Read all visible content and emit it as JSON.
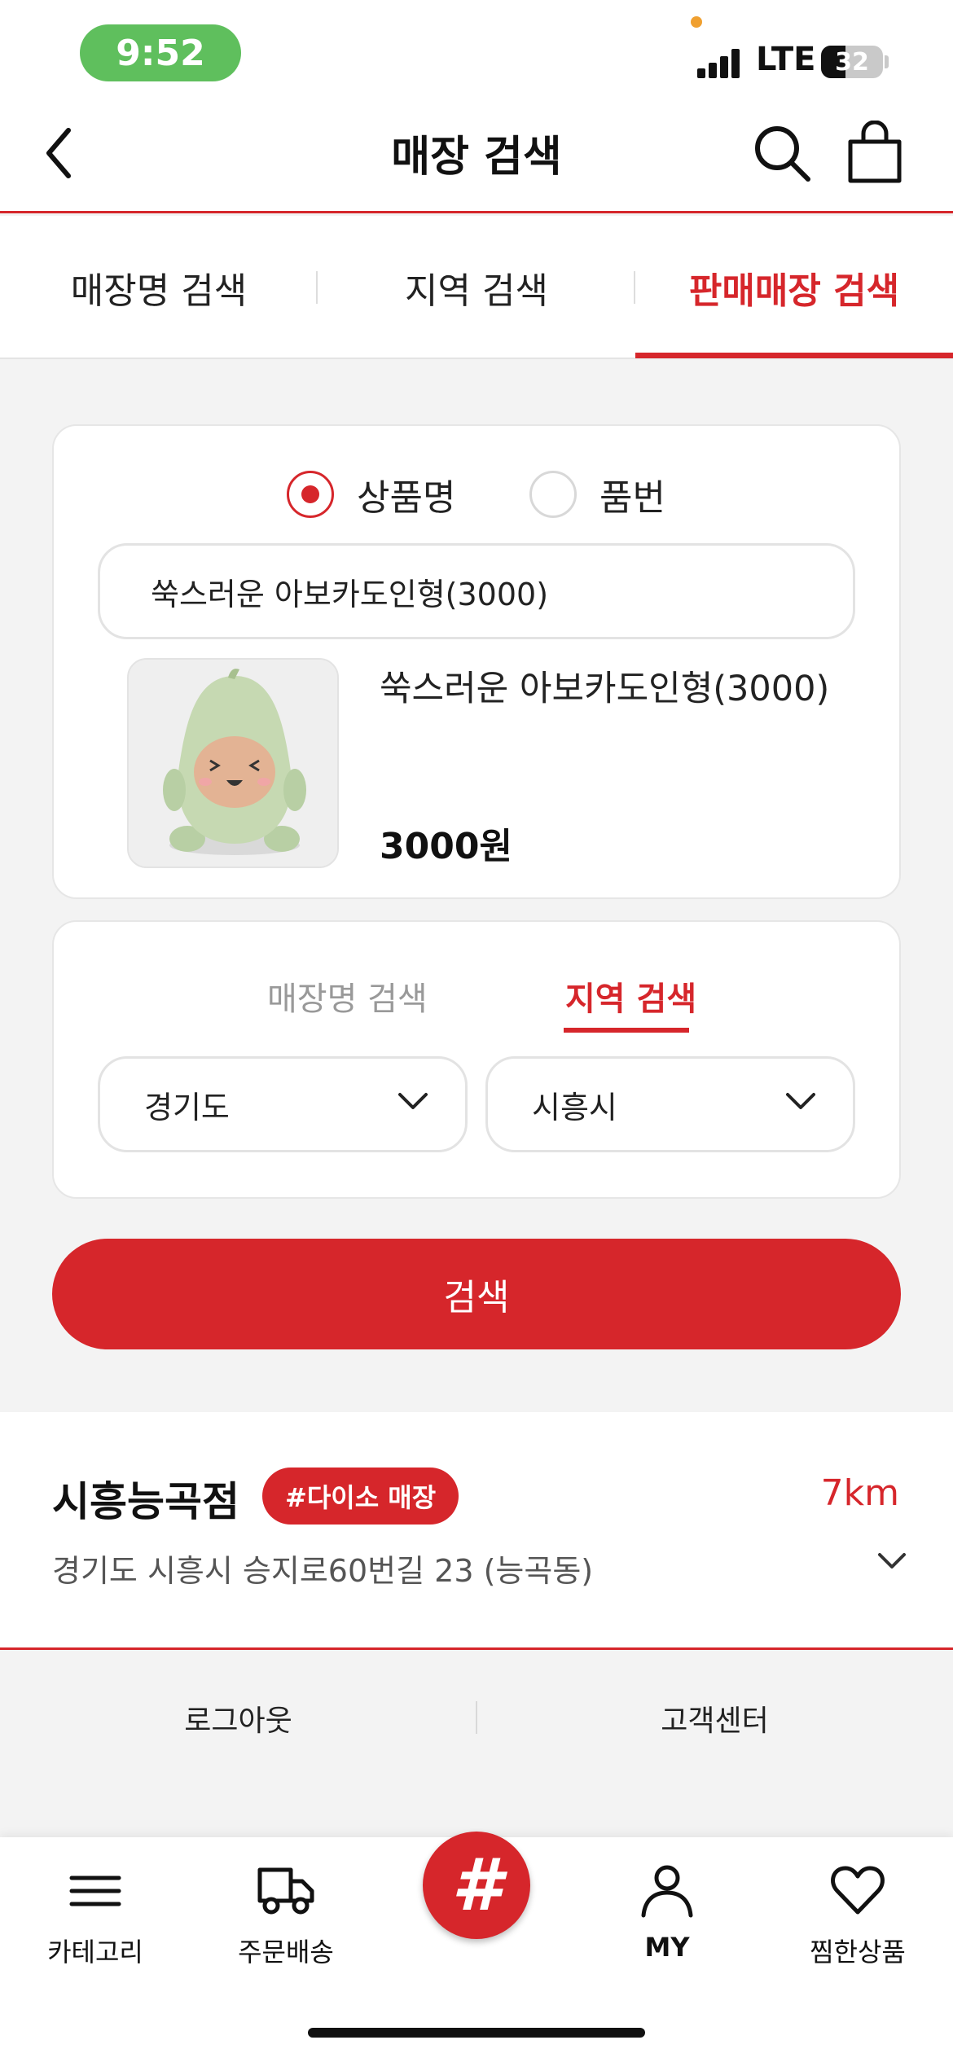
{
  "status_bar": {
    "time": "9:52",
    "network": "LTE",
    "battery": "32"
  },
  "header": {
    "title": "매장 검색"
  },
  "tabs": [
    {
      "label": "매장명 검색"
    },
    {
      "label": "지역 검색"
    },
    {
      "label": "판매매장 검색",
      "active": true
    }
  ],
  "product_search": {
    "radio_options": [
      {
        "label": "상품명",
        "selected": true
      },
      {
        "label": "품번",
        "selected": false
      }
    ],
    "input_value": "쑥스러운 아보카도인형(3000)",
    "product": {
      "name": "쑥스러운 아보카도인형(3000)",
      "price": "3000원"
    }
  },
  "store_filter": {
    "sub_tabs": [
      {
        "label": "매장명 검색",
        "active": false
      },
      {
        "label": "지역 검색",
        "active": true
      }
    ],
    "province": "경기도",
    "city": "시흥시"
  },
  "search_button": "검색",
  "result": {
    "store_name": "시흥능곡점",
    "badge": "#다이소 매장",
    "distance": "7km",
    "address": "경기도 시흥시 승지로60번길 23 (능곡동)"
  },
  "footer": {
    "logout": "로그아웃",
    "customer_center": "고객센터"
  },
  "bottom_nav": {
    "category": "카테고리",
    "order_delivery": "주문배송",
    "center": "#",
    "my": "MY",
    "wishlist": "찜한상품"
  },
  "colors": {
    "accent": "#d6262b",
    "time_pill": "#5fbf5d",
    "background": "#f3f3f3"
  }
}
